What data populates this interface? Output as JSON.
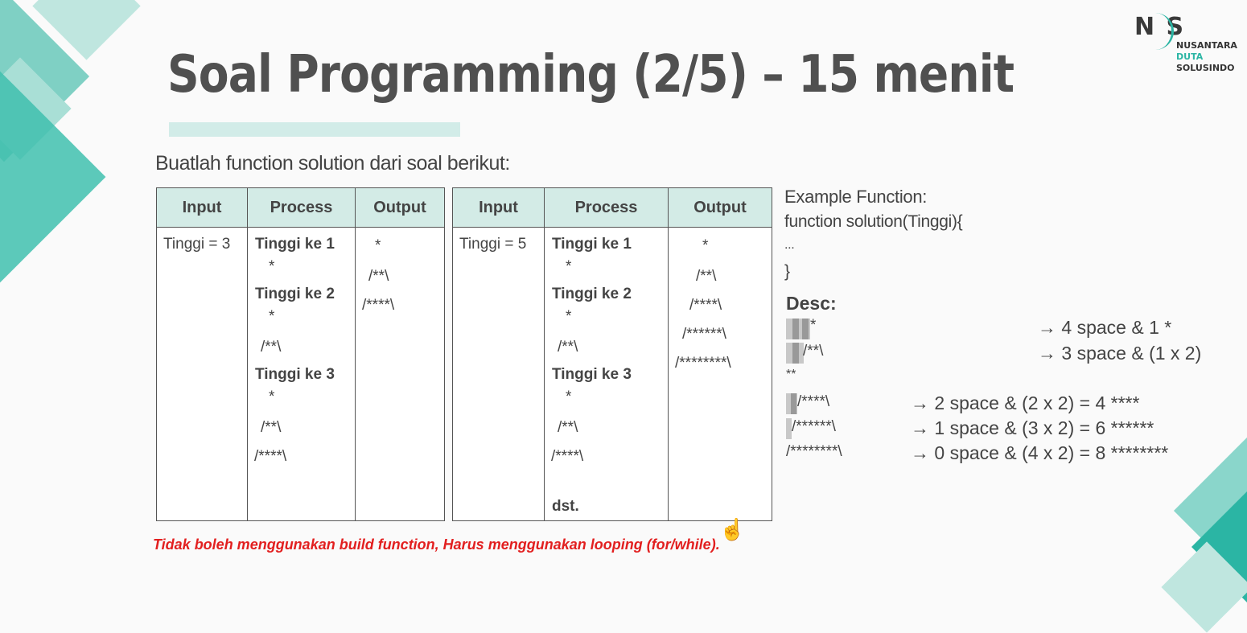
{
  "title": "Soal Programming (2/5) – 15 menit",
  "subtitle": "Buatlah function solution dari soal berikut:",
  "logo": {
    "mark": "N S",
    "line1": "NUSANTARA",
    "line2": "DUTA",
    "line3": "SOLUSINDO"
  },
  "headers": {
    "input": "Input",
    "process": "Process",
    "output": "Output"
  },
  "table1": {
    "input": "Tinggi = 3",
    "process": [
      "Tinggi ke 1",
      "*",
      "Tinggi ke 2",
      "*",
      "/**\\",
      "Tinggi ke 3",
      "*",
      "/**\\",
      "/****\\"
    ],
    "output": [
      "*",
      "/**\\",
      "/****\\"
    ]
  },
  "table2": {
    "input": "Tinggi = 5",
    "process": [
      "Tinggi ke 1",
      "*",
      "Tinggi ke 2",
      "*",
      "/**\\",
      "Tinggi ke 3",
      "*",
      "/**\\",
      "/****\\",
      "dst."
    ],
    "output": [
      "*",
      "/**\\",
      "/****\\",
      "/******\\",
      "/********\\"
    ]
  },
  "example": {
    "heading": "Example Function:",
    "lines": [
      "function solution(Tinggi){",
      "...",
      "}"
    ]
  },
  "desc": {
    "heading": "Desc:",
    "patterns": [
      "*",
      "/**\\",
      "**",
      "/****\\",
      "/******\\",
      "/********\\"
    ],
    "explanations": [
      "→ 4 space & 1 *",
      "→ 3 space & (1 x 2)",
      "→ 2 space & (2 x 2) = 4 ****",
      "→ 1 space & (3 x 2) = 6 ******",
      "→ 0 space & (4 x 2) = 8 ********"
    ]
  },
  "warning": "Tidak boleh menggunakan build function, Harus menggunakan looping (for/while).",
  "colors": {
    "accent": "#2bb5a4",
    "header_bg": "#d3ebe6",
    "warning": "#e21f1f",
    "title": "#505050"
  }
}
